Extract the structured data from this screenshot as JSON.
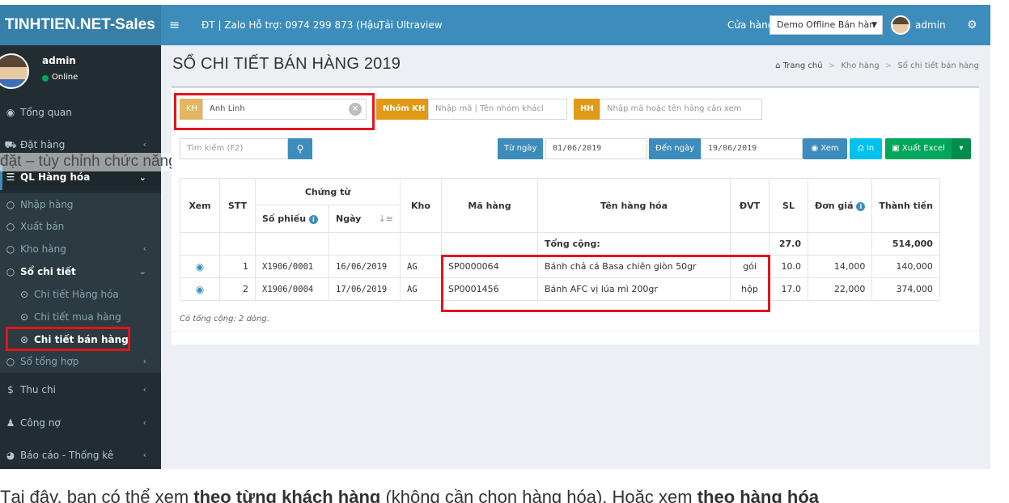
{
  "app": {
    "logo": "TINHTIEN.NET-Sales",
    "hamburger_icon": "bars-icon",
    "phone_link": "ĐT | Zalo Hỗ trợ: 0974 299 873 (Hậu)",
    "ultraview_link": "Tải Ultraview",
    "store_label": "Cửa hàng",
    "store_select_value": "Demo Offline Bán hàn",
    "store_caret": "▼",
    "username": "admin",
    "settings_icon": "cogs-icon"
  },
  "sidebar": {
    "username": "admin",
    "status": "Online",
    "status_color": "#00a65a",
    "items": [
      {
        "label": "Tổng quan",
        "icon": "dashboard-icon",
        "glyph": "◉"
      },
      {
        "label": "Đặt hàng",
        "icon": "cart-icon",
        "glyph": "⛟",
        "arrow": "‹"
      },
      {
        "label": "QL Hàng hóa",
        "icon": "list-icon",
        "glyph": "☰",
        "arrow": "⌄"
      },
      {
        "label": "Nhập hàng",
        "glyph": "○"
      },
      {
        "label": "Xuất bán",
        "glyph": "○"
      },
      {
        "label": "Kho hàng",
        "glyph": "○",
        "arrow": "‹"
      },
      {
        "label": "Sổ chi tiết",
        "glyph": "○",
        "arrow": "⌄"
      },
      {
        "label": "Chi tiết Hàng hóa",
        "glyph": "⊙"
      },
      {
        "label": "Chi tiết mua hàng",
        "glyph": "⊙"
      },
      {
        "label": "Chi tiết bán hàng",
        "glyph": "⊙"
      },
      {
        "label": "Sổ tổng hợp",
        "glyph": "○",
        "arrow": "‹"
      },
      {
        "label": "Thu chi",
        "icon": "dollar-icon",
        "glyph": "$",
        "arrow": "‹"
      },
      {
        "label": "Công nợ",
        "icon": "user-icon",
        "glyph": "♟",
        "arrow": "‹"
      },
      {
        "label": "Báo cáo - Thống kê",
        "icon": "pie-chart-icon",
        "glyph": "◕",
        "arrow": "‹"
      }
    ]
  },
  "overlay_text": "đặt – tùy chỉnh chức năng",
  "page": {
    "title": "SỔ CHI TIẾT BÁN HÀNG 2019",
    "breadcrumb": [
      "Trang chủ",
      "Kho hàng",
      "Sổ chi tiết bán hàng"
    ],
    "breadcrumb_sep": ">",
    "home_icon_glyph": "⌂"
  },
  "filters": {
    "kh_label": "KH",
    "kh_value": "Anh Linh",
    "kh_clear_glyph": "×",
    "nhomkh_label": "Nhóm KH",
    "nhomkh_placeholder": "Nhập mã | Tên nhóm khácl",
    "hh_label": "HH",
    "hh_placeholder": "Nhập mã hoặc tên hàng cần xem",
    "search_placeholder": "Tìm kiếm (F2)",
    "search_glyph": "⚲",
    "tungay_label": "Từ ngày",
    "tungay_value": "01/06/2019",
    "denngay_label": "Đến ngày",
    "denngay_value": "19/06/2019",
    "xem_label": "Xem",
    "xem_glyph": "◉",
    "in_label": "In",
    "in_glyph": "⎙",
    "excel_label": "Xuất Excel",
    "excel_glyph": "▣",
    "excel_caret": "▾"
  },
  "table": {
    "headers": {
      "xem": "Xem",
      "stt": "STT",
      "chungtu": "Chứng từ",
      "sophieu": "Số phiếu",
      "ngay": "Ngày",
      "kho": "Kho",
      "mahang": "Mã hàng",
      "tenhang": "Tên hàng hóa",
      "dvt": "ĐVT",
      "sl": "SL",
      "dongia": "Đơn giá",
      "thanhtien": "Thành tiền"
    },
    "info_glyph": "i",
    "sort_glyph": "↓≡",
    "total_label": "Tổng cộng:",
    "total_sl": "27.0",
    "total_thanhtien": "514,000",
    "eye_glyph": "◉",
    "rows": [
      {
        "stt": "1",
        "sophieu": "X1906/0001",
        "ngay": "16/06/2019",
        "kho": "AG",
        "mahang": "SP0000064",
        "tenhang": "Bánh chả cá Basa chiên giòn 50gr",
        "dvt": "gói",
        "sl": "10.0",
        "dongia": "14,000",
        "thanhtien": "140,000"
      },
      {
        "stt": "2",
        "sophieu": "X1906/0004",
        "ngay": "17/06/2019",
        "kho": "AG",
        "mahang": "SP0001456",
        "tenhang": "Bánh AFC vị lúa mì 200gr",
        "dvt": "hộp",
        "sl": "17.0",
        "dongia": "22,000",
        "thanhtien": "374,000"
      }
    ],
    "footer_note": "Có tổng cộng: 2 dòng."
  },
  "caption": {
    "part1": "Tại đây, bạn có thể xem ",
    "bold1": "theo từng khách hàng",
    "part2": " (không cần chọn hàng hóa). Hoặc xem ",
    "bold2": "theo hàng hóa"
  },
  "colors": {
    "header_bg": "#3c8dbc",
    "logo_bg": "#367fa9",
    "sidebar_bg": "#222d32",
    "highlight": "#e3141b",
    "excel_green": "#00a65a",
    "print_cyan": "#00c0ef"
  }
}
